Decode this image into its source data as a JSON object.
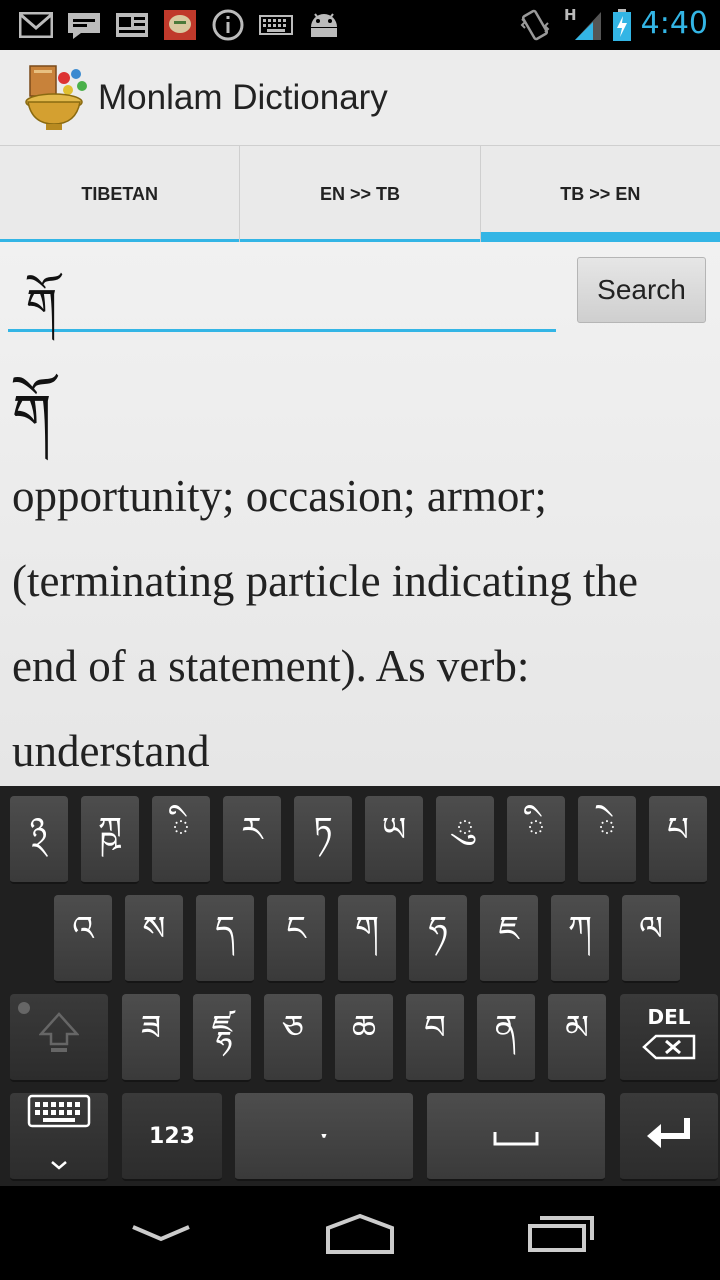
{
  "status_bar": {
    "time": "4:40",
    "icons": [
      "gmail-icon",
      "message-icon",
      "news-icon",
      "app-notification-icon",
      "info-icon",
      "keyboard-icon",
      "android-icon",
      "vibrate-icon",
      "signal-icon",
      "battery-charging-icon"
    ],
    "network_label": "H",
    "accent_color": "#33b5e5"
  },
  "action_bar": {
    "title": "Monlam Dictionary",
    "icon": "monlam-app-icon"
  },
  "tabs": [
    {
      "label": "TIBETAN",
      "selected": false
    },
    {
      "label": "EN >> TB",
      "selected": false
    },
    {
      "label": "TB >> EN",
      "selected": true
    }
  ],
  "search": {
    "value": "གོ",
    "button_label": "Search"
  },
  "result": {
    "headword": "གོ",
    "definition": "opportunity; occasion; armor; (terminating particle indicating the end of a statement). As verb: understand"
  },
  "keyboard": {
    "row1": [
      "྅",
      "ཀྵ",
      "ི",
      "ར",
      "ཏ",
      "ཡ",
      "ུ",
      "ི",
      "ེ",
      "པ"
    ],
    "row2": [
      "འ",
      "ས",
      "ད",
      "ང",
      "ག",
      "ཧ",
      "ཇ",
      "ཀ",
      "ལ"
    ],
    "row3": [
      "ཟ",
      "ཛྷ",
      "ཅ",
      "ཆ",
      "བ",
      "ན",
      "མ"
    ],
    "symbols_label": "123",
    "tsheg_label": "་",
    "delete_label": "DEL"
  },
  "nav_bar": {
    "icons": [
      "back-icon",
      "home-icon",
      "recents-icon"
    ]
  }
}
